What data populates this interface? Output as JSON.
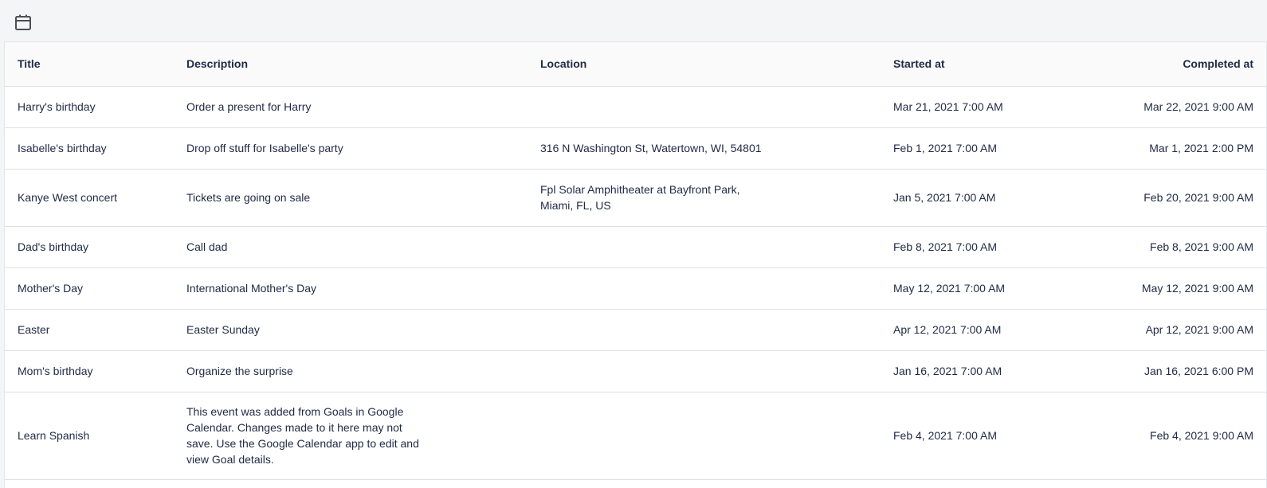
{
  "toolbar": {
    "icon": "calendar-icon"
  },
  "table": {
    "headers": {
      "title": "Title",
      "description": "Description",
      "location": "Location",
      "started_at": "Started at",
      "completed_at": "Completed at"
    },
    "rows": [
      {
        "title": "Harry's birthday",
        "description": "Order a present for Harry",
        "location": "",
        "started_at": "Mar 21, 2021 7:00 AM",
        "completed_at": "Mar 22, 2021 9:00 AM"
      },
      {
        "title": "Isabelle's birthday",
        "description": "Drop off stuff for Isabelle's party",
        "location": "316 N Washington St, Watertown, WI, 54801",
        "started_at": "Feb 1, 2021 7:00 AM",
        "completed_at": "Mar 1, 2021 2:00 PM"
      },
      {
        "title": "Kanye West concert",
        "description": "Tickets are going on sale",
        "location": "Fpl Solar Amphitheater at Bayfront Park, Miami, FL, US",
        "started_at": "Jan 5, 2021 7:00 AM",
        "completed_at": "Feb 20, 2021 9:00 AM"
      },
      {
        "title": "Dad's birthday",
        "description": "Call dad",
        "location": "",
        "started_at": "Feb 8, 2021 7:00 AM",
        "completed_at": "Feb 8, 2021 9:00 AM"
      },
      {
        "title": "Mother's Day",
        "description": "International Mother's Day",
        "location": "",
        "started_at": "May 12, 2021 7:00 AM",
        "completed_at": "May 12, 2021 9:00 AM"
      },
      {
        "title": "Easter",
        "description": "Easter Sunday",
        "location": "",
        "started_at": "Apr 12, 2021 7:00 AM",
        "completed_at": "Apr 12, 2021 9:00 AM"
      },
      {
        "title": "Mom's birthday",
        "description": "Organize the surprise",
        "location": "",
        "started_at": "Jan 16, 2021 7:00 AM",
        "completed_at": "Jan 16, 2021 6:00 PM"
      },
      {
        "title": "Learn Spanish",
        "description": "This event was added from Goals in Google Calendar. Changes made to it here may not save. Use the Google Calendar app to edit and view Goal details.",
        "location": "",
        "started_at": "Feb 4, 2021 7:00 AM",
        "completed_at": "Feb 4, 2021 9:00 AM"
      }
    ]
  }
}
